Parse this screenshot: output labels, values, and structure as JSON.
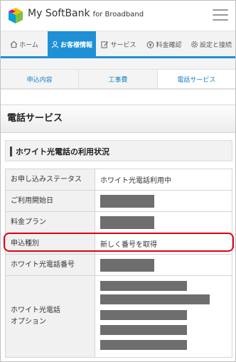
{
  "header": {
    "brand_name": "My SoftBank",
    "brand_sub": "for Broadband",
    "logo_icon": "softbank-cube-logo",
    "menu_icon": "hamburger-menu-icon"
  },
  "global_nav": [
    {
      "label": "ホーム",
      "icon": "home-icon"
    },
    {
      "label": "お客様情報",
      "icon": "user-icon"
    },
    {
      "label": "サービス",
      "icon": "edit-icon"
    },
    {
      "label": "料金確認",
      "icon": "yen-icon"
    },
    {
      "label": "設定と接続",
      "icon": "gear-icon"
    }
  ],
  "sub_tabs": [
    "申込内容",
    "工事費",
    "電話サービス"
  ],
  "page": {
    "title": "電話サービス",
    "section_title": "ホワイト光電話の利用状況"
  },
  "table": {
    "rows": [
      {
        "label": "お申し込みステータス",
        "value": "ホワイト光電話利用中"
      },
      {
        "label": "ご利用開始日",
        "value": ""
      },
      {
        "label": "料金プラン",
        "value": ""
      },
      {
        "label": "申込種別",
        "value": "新しく番号を取得"
      },
      {
        "label": "ホワイト光電話番号",
        "value": ""
      },
      {
        "label": "ホワイト光電話\nオプション",
        "value": ""
      }
    ]
  },
  "colors": {
    "accent": "#1e90d6",
    "highlight": "#e00012",
    "redaction": "#6e6e6e"
  }
}
